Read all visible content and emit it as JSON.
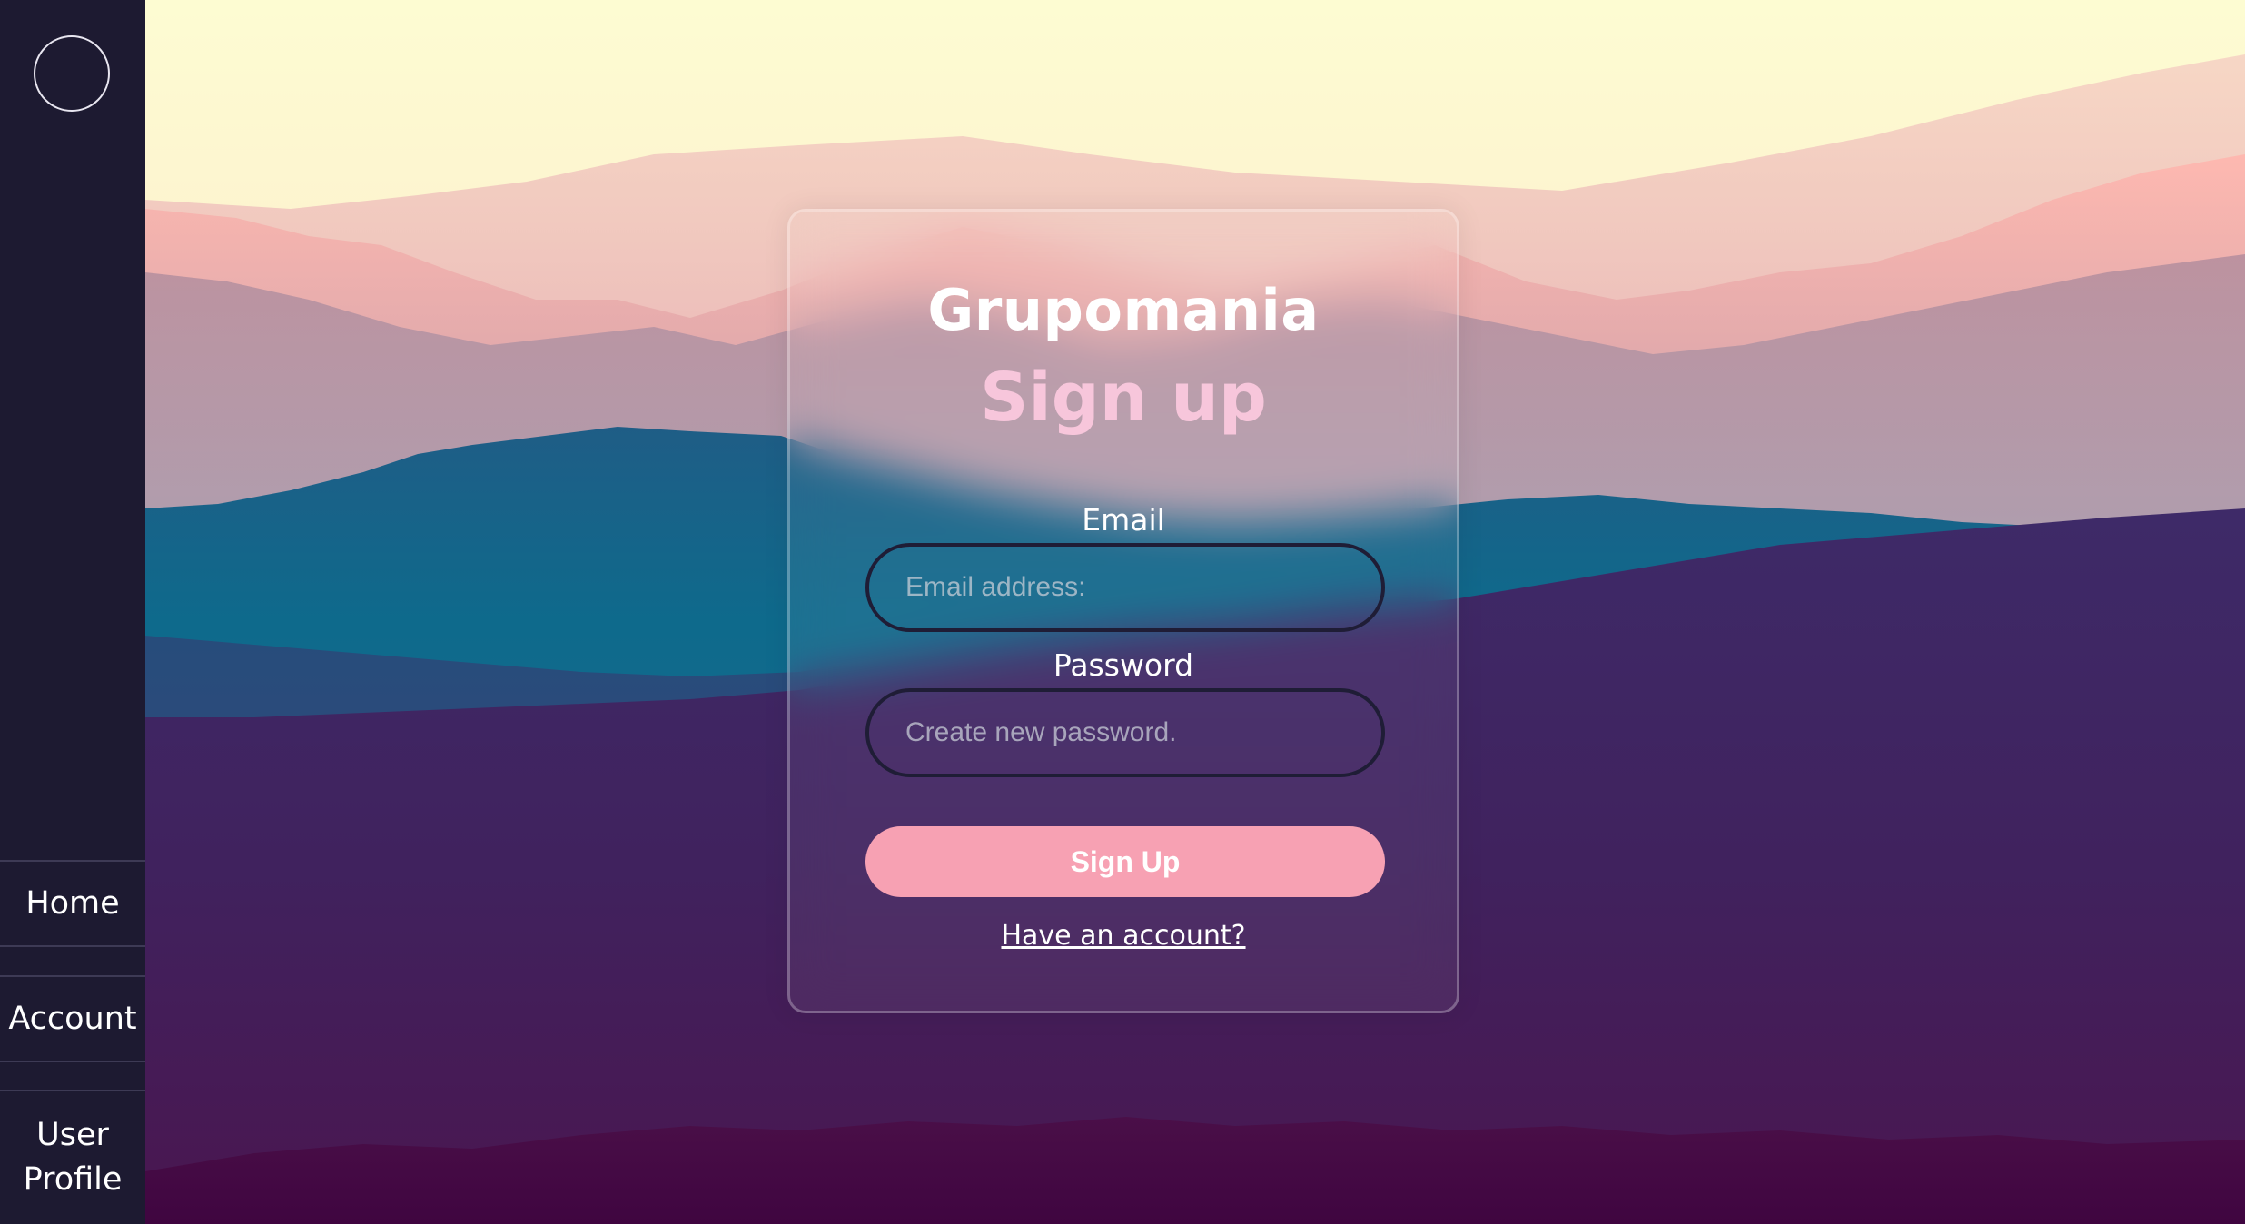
{
  "sidebar": {
    "items": [
      {
        "label": "Home"
      },
      {
        "label": "Account"
      },
      {
        "label": "User Profile"
      }
    ]
  },
  "card": {
    "brand": "Grupomania",
    "title": "Sign up",
    "email_label": "Email",
    "email_placeholder": "Email address:",
    "password_label": "Password",
    "password_placeholder": "Create new password.",
    "submit_label": "Sign Up",
    "login_link": "Have an account?"
  },
  "colors": {
    "sidebar": "#1d1a31",
    "button": "#f7a1b3",
    "title": "#f7c6db",
    "sky": "#fdfbd3"
  }
}
